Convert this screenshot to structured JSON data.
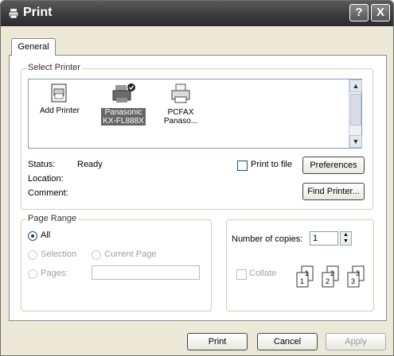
{
  "window": {
    "title": "Print",
    "help_symbol": "?",
    "close_symbol": "X"
  },
  "tabs": [
    {
      "label": "General",
      "active": true
    }
  ],
  "select_printer": {
    "legend": "Select Printer",
    "printers": [
      {
        "label_line1": "Add Printer",
        "label_line2": "",
        "icon": "add-printer-icon",
        "selected": false
      },
      {
        "label_line1": "Panasonic",
        "label_line2": "KX-FL888X",
        "icon": "printer-default-icon",
        "selected": true
      },
      {
        "label_line1": "PCFAX",
        "label_line2": "Panaso...",
        "icon": "fax-printer-icon",
        "selected": false
      }
    ],
    "status_label": "Status:",
    "status_value": "Ready",
    "location_label": "Location:",
    "location_value": "",
    "comment_label": "Comment:",
    "comment_value": "",
    "print_to_file_label": "Print to file",
    "print_to_file_checked": false,
    "preferences_button": "Preferences",
    "find_printer_button": "Find Printer..."
  },
  "page_range": {
    "legend": "Page Range",
    "all_label": "All",
    "all_selected": true,
    "selection_label": "Selection",
    "current_page_label": "Current Page",
    "pages_label": "Pages:",
    "pages_value": ""
  },
  "copies": {
    "number_label": "Number of copies:",
    "number_value": "1",
    "collate_label": "Collate",
    "collate_checked": false
  },
  "footer": {
    "print_button": "Print",
    "cancel_button": "Cancel",
    "apply_button": "Apply"
  }
}
